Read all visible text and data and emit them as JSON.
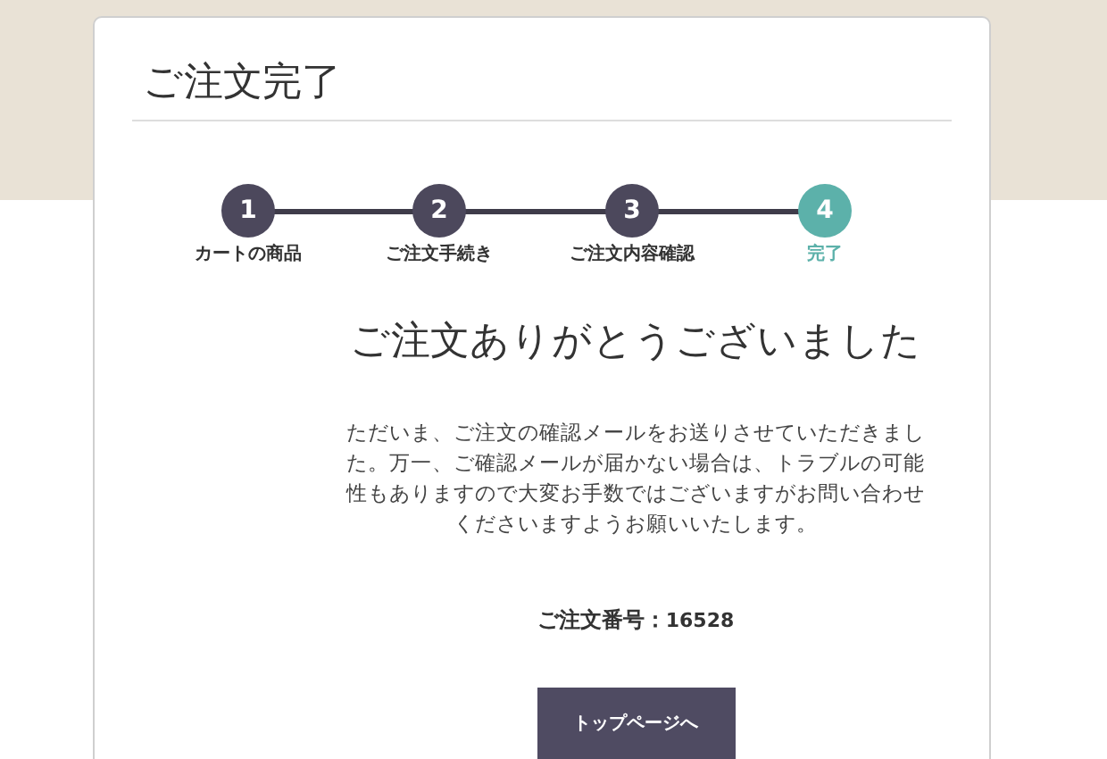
{
  "page_title": "ご注文完了",
  "steps": [
    {
      "number": "1",
      "label": "カートの商品",
      "selected": false
    },
    {
      "number": "2",
      "label": "ご注文手続き",
      "selected": false
    },
    {
      "number": "3",
      "label": "ご注文内容確認",
      "selected": false
    },
    {
      "number": "4",
      "label": "完了",
      "selected": true
    }
  ],
  "heading": "ご注文ありがとうございました",
  "message": "ただいま、ご注文の確認メールをお送りさせていただきました。万一、ご確認メールが届かない場合は、トラブルの可能性もありますので大変お手数ではございますがお問い合わせくださいますようお願いいたします。",
  "order_number": {
    "label": "ご注文番号：",
    "value": "16528"
  },
  "button": "トップページへ"
}
